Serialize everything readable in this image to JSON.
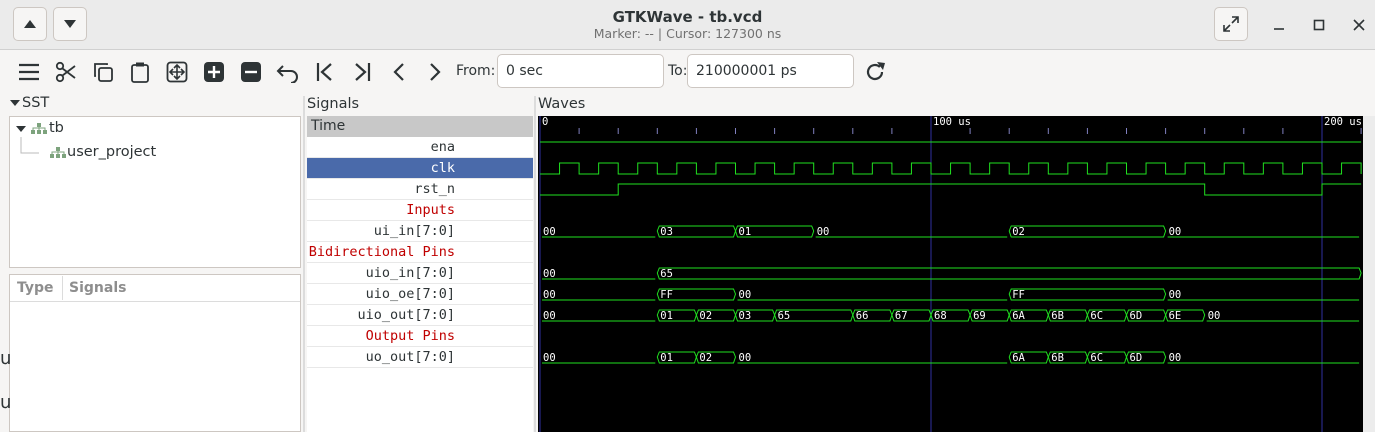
{
  "window": {
    "title": "GTKWave - tb.vcd",
    "subtitle": "Marker: --  |  Cursor: 127300 ns"
  },
  "toolbar": {
    "from_label": "From:",
    "from_value": "0 sec",
    "to_label": "To:",
    "to_value": "210000001 ps",
    "icons": [
      "menu-icon",
      "cut-icon",
      "copy-icon",
      "paste-icon",
      "zoom-fit-icon",
      "zoom-in-icon",
      "zoom-out-icon",
      "undo-icon",
      "jump-start-icon",
      "jump-end-icon",
      "prev-edge-icon",
      "next-edge-icon",
      "reload-icon"
    ]
  },
  "sst": {
    "header": "SST",
    "tree": [
      {
        "label": "tb",
        "level": 0,
        "expanded": true
      },
      {
        "label": "user_project",
        "level": 1,
        "expanded": false
      }
    ],
    "columns": [
      "Type",
      "Signals"
    ]
  },
  "signals": {
    "header": "Signals",
    "time_label": "Time",
    "rows": [
      {
        "name": "ena",
        "kind": "signal"
      },
      {
        "name": "clk",
        "kind": "signal",
        "selected": true
      },
      {
        "name": "rst_n",
        "kind": "signal"
      },
      {
        "name": "Inputs",
        "kind": "comment"
      },
      {
        "name": "ui_in[7:0]",
        "kind": "signal"
      },
      {
        "name": "Bidirectional Pins",
        "kind": "comment"
      },
      {
        "name": "uio_in[7:0]",
        "kind": "signal"
      },
      {
        "name": "uio_oe[7:0]",
        "kind": "signal"
      },
      {
        "name": "uio_out[7:0]",
        "kind": "signal"
      },
      {
        "name": "Output Pins",
        "kind": "comment"
      },
      {
        "name": "uo_out[7:0]",
        "kind": "signal"
      }
    ]
  },
  "waves": {
    "header": "Waves",
    "time_unit": "us",
    "time_ticks": [
      {
        "t": 0,
        "label": "0"
      },
      {
        "t": 100,
        "label": "100 us"
      },
      {
        "t": 200,
        "label": "200 us"
      }
    ],
    "view_end_us": 210,
    "clk_period_us": 10,
    "ena": [
      [
        0,
        1
      ]
    ],
    "rst_n": [
      [
        0,
        0
      ],
      [
        20,
        1
      ],
      [
        170,
        0
      ],
      [
        200,
        1
      ]
    ],
    "buses": {
      "ui_in": [
        [
          0,
          "00"
        ],
        [
          30,
          "03"
        ],
        [
          50,
          "01"
        ],
        [
          70,
          "00"
        ],
        [
          120,
          "02"
        ],
        [
          160,
          "00"
        ]
      ],
      "uio_in": [
        [
          0,
          "00"
        ],
        [
          30,
          "65"
        ]
      ],
      "uio_oe": [
        [
          0,
          "00"
        ],
        [
          30,
          "FF"
        ],
        [
          50,
          "00"
        ],
        [
          120,
          "FF"
        ],
        [
          160,
          "00"
        ]
      ],
      "uio_out": [
        [
          0,
          "00"
        ],
        [
          30,
          "01"
        ],
        [
          40,
          "02"
        ],
        [
          50,
          "03"
        ],
        [
          60,
          "65"
        ],
        [
          80,
          "66"
        ],
        [
          90,
          "67"
        ],
        [
          100,
          "68"
        ],
        [
          110,
          "69"
        ],
        [
          120,
          "6A"
        ],
        [
          130,
          "6B"
        ],
        [
          140,
          "6C"
        ],
        [
          150,
          "6D"
        ],
        [
          160,
          "6E"
        ],
        [
          170,
          "00"
        ]
      ],
      "uo_out": [
        [
          0,
          "00"
        ],
        [
          30,
          "01"
        ],
        [
          40,
          "02"
        ],
        [
          50,
          "00"
        ],
        [
          120,
          "6A"
        ],
        [
          130,
          "6B"
        ],
        [
          140,
          "6C"
        ],
        [
          150,
          "6D"
        ],
        [
          160,
          "00"
        ]
      ]
    },
    "colors": {
      "trace": "#20e020",
      "grid": "#3030a0",
      "comment_text": "#c00000",
      "selected_row": "#4a6aaa"
    }
  }
}
